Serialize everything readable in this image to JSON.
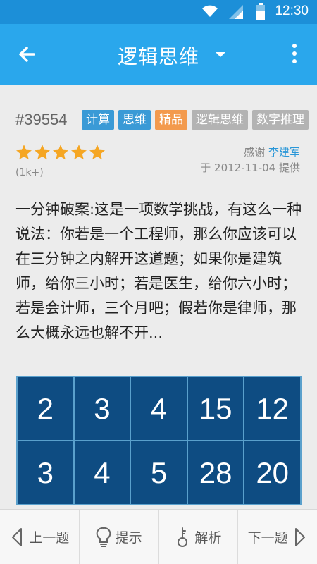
{
  "status_bar": {
    "time": "12:30",
    "icons": [
      "wifi-icon",
      "signal-icon",
      "battery-icon"
    ]
  },
  "app_bar": {
    "title": "逻辑思维",
    "back_icon": "arrow-left-icon",
    "dropdown_icon": "caret-down-icon",
    "menu_icon": "more-vert-icon"
  },
  "question": {
    "id": "#39554",
    "tags": [
      {
        "label": "计算",
        "color": "blue"
      },
      {
        "label": "思维",
        "color": "blue"
      },
      {
        "label": "精品",
        "color": "orange"
      },
      {
        "label": "逻辑思维",
        "color": "gray"
      },
      {
        "label": "数字推理",
        "color": "gray"
      }
    ],
    "rating_stars": 5,
    "rating_count": "(1k+)",
    "thanks_label": "感谢",
    "author": "李建军",
    "provided": "于 2012-11-04 提供",
    "text": "一分钟破案:这是一项数学挑战，有这么一种说法：你若是一个工程师，那么你应该可以在三分钟之内解开这道题；如果你是建筑师，给你三小时；若是医生，给你六小时；若是会计师，三个月吧；假若你是律师，那么大概永远也解不开...",
    "grid": [
      [
        "2",
        "3",
        "4",
        "15",
        "12"
      ],
      [
        "3",
        "4",
        "5",
        "28",
        "20"
      ]
    ]
  },
  "bottom_bar": {
    "prev": "上一题",
    "hint": "提示",
    "analysis": "解析",
    "next": "下一题"
  },
  "colors": {
    "status_bar": "#1c8fd8",
    "app_bar": "#2aa7ec",
    "grid_cell": "#0e4c82",
    "star": "#f5a623"
  }
}
